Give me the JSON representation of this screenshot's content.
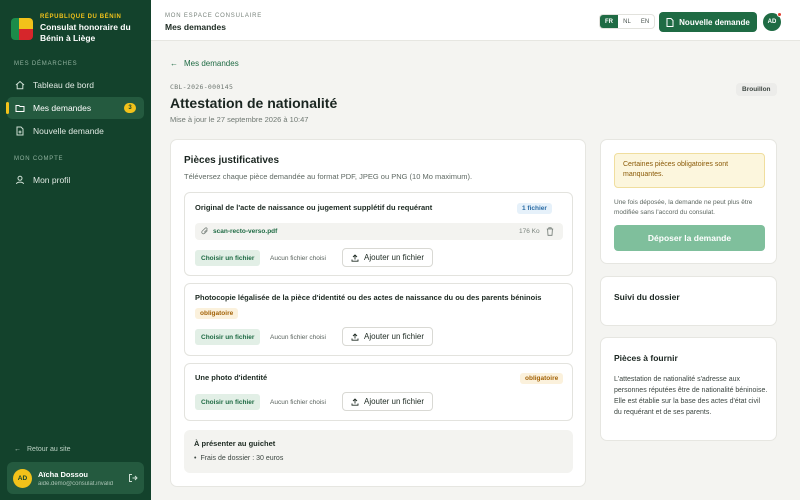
{
  "sidebar": {
    "brand_sup": "RÉPUBLIQUE DU BÉNIN",
    "brand_name": "Consulat honoraire du Bénin à Liège",
    "section_requests": "MES DÉMARCHES",
    "items": [
      {
        "label": "Tableau de bord"
      },
      {
        "label": "Mes demandes",
        "badge": "3"
      },
      {
        "label": "Nouvelle demande"
      }
    ],
    "section_account": "MON COMPTE",
    "profile_label": "Mon profil",
    "back_label": "Retour au site",
    "user": {
      "initials": "AD",
      "name": "Aïcha Dossou",
      "email": "aide.demo@consulat.invalid"
    }
  },
  "topbar": {
    "sup": "MON ESPACE CONSULAIRE",
    "title": "Mes demandes",
    "langs": [
      "FR",
      "NL",
      "EN"
    ],
    "new_request": "Nouvelle demande",
    "avatar": "AD"
  },
  "request": {
    "back": "Mes demandes",
    "ref": "CBL-2026-000145",
    "title": "Attestation de nationalité",
    "updated": "Mise à jour le 27 septembre 2026 à 10:47",
    "status": "Brouillon"
  },
  "documents": {
    "title": "Pièces justificatives",
    "subtitle": "Téléversez chaque pièce demandée au format PDF, JPEG ou PNG (10 Mo maximum).",
    "choose_label": "Choisir un fichier",
    "no_file": "Aucun fichier choisi",
    "add_label": "Ajouter un fichier",
    "pieces": [
      {
        "title": "Original de l'acte de naissance ou jugement supplétif du requérant",
        "tag": "1 fichier",
        "file": {
          "name": "scan-recto-verso.pdf",
          "size": "176 Ko"
        }
      },
      {
        "title": "Photocopie légalisée de la pièce d'identité ou des actes de naissance du ou des parents béninois",
        "tag": "obligatoire"
      },
      {
        "title": "Une photo d'identité",
        "tag": "obligatoire"
      }
    ],
    "guichet": {
      "title": "À présenter au guichet",
      "items": [
        "Frais de dossier : 30 euros"
      ]
    }
  },
  "submit": {
    "warning": "Certaines pièces obligatoires sont manquantes.",
    "note": "Une fois déposée, la demande ne peut plus être modifiée sans l'accord du consulat.",
    "button": "Déposer la demande"
  },
  "suivi": {
    "title": "Suivi du dossier"
  },
  "pieces_info": {
    "title": "Pièces à fournir",
    "text": "L'attestation de nationalité s'adresse aux personnes réputées être de nationalité béninoise. Elle est établie sur la base des actes d'état civil du requérant et de ses parents."
  },
  "colors": {
    "primary": "#1f6b44",
    "sidebar": "#13422c",
    "accent": "#f2c21a",
    "warning_bg": "#fcf6dd"
  }
}
